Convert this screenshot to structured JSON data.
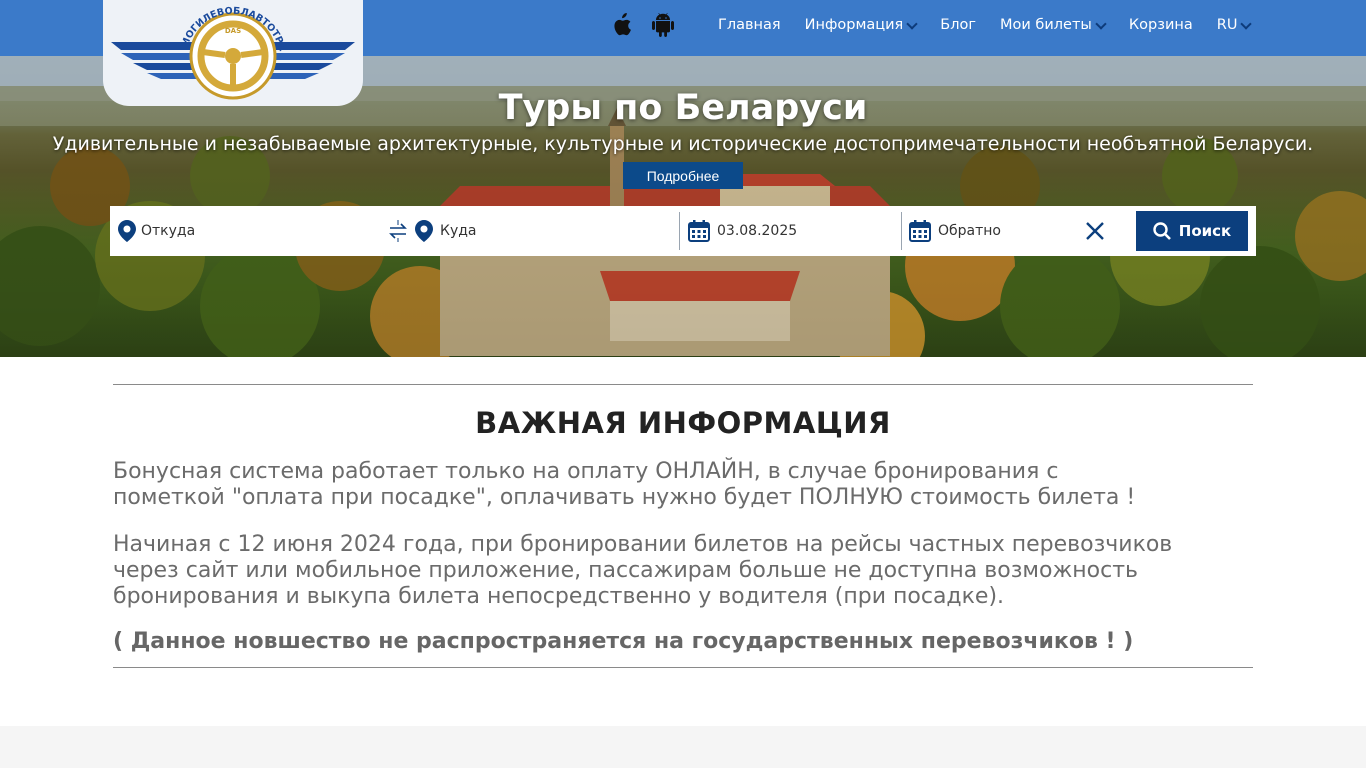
{
  "logo": {
    "text": "МОГИЛЕВОБЛАВТОТРАНС",
    "badge": "DAS"
  },
  "nav": {
    "apple_icon": "apple-icon",
    "android_icon": "android-icon",
    "items": [
      {
        "label": "Главная"
      },
      {
        "label": "Информация",
        "dropdown": true
      },
      {
        "label": "Блог"
      },
      {
        "label": "Мои билеты",
        "dropdown": true
      },
      {
        "label": "Корзина"
      },
      {
        "label": "RU",
        "dropdown": true
      }
    ]
  },
  "hero": {
    "title": "Туры по Беларуси",
    "subtitle": "Удивительные и незабываемые архитектурные, культурные и исторические достопримечательности необъятной Беларуси.",
    "button": "Подробнее"
  },
  "search": {
    "from_placeholder": "Откуда",
    "to_placeholder": "Куда",
    "date_value": "03.08.2025",
    "return_placeholder": "Обратно",
    "button": "Поиск"
  },
  "info": {
    "title": "ВАЖНАЯ ИНФОРМАЦИЯ",
    "p1_line1": "Бонусная система работает только на оплату ОНЛАЙН, в случае бронирования с",
    "p1_line2": "пометкой \"оплата при посадке\",  оплачивать нужно будет ПОЛНУЮ стоимость билета !",
    "p2_line1": "Начиная с 12 июня 2024 года, при бронировании билетов на рейсы частных перевозчиков",
    "p2_line2": "через сайт или мобильное приложение, пассажирам больше не доступна возможность",
    "p2_line3": "бронирования и выкупа билета непосредственно у водителя (при посадке).",
    "note": "( Данное новшество не распространяется на государственных перевозчиков ! )"
  },
  "colors": {
    "topbar": "#3b7ac9",
    "primary": "#0c3f7e",
    "icon": "#0c4a8a"
  }
}
